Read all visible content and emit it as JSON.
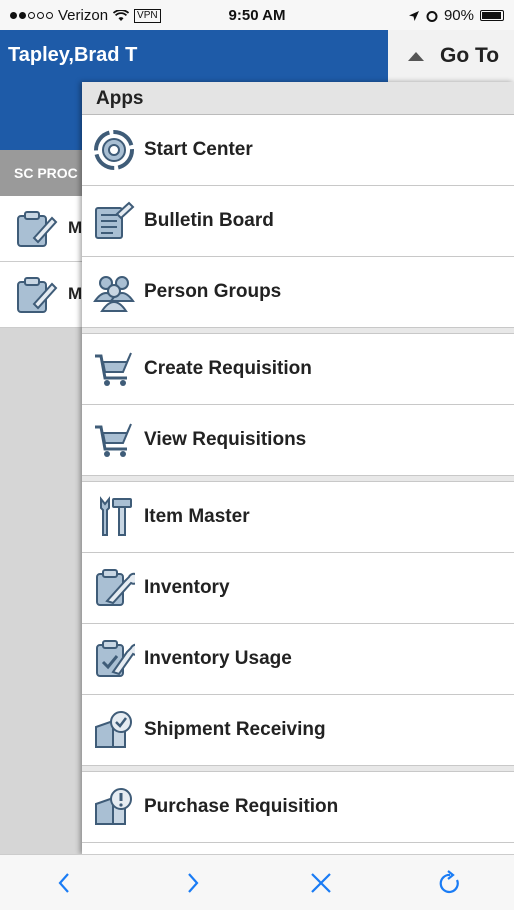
{
  "status": {
    "carrier": "Verizon",
    "vpn": "VPN",
    "time": "9:50 AM",
    "battery": "90%"
  },
  "header": {
    "user": "Tapley,Brad T",
    "goto_label": "Go To"
  },
  "background": {
    "section_label": "SC PROC",
    "rows": [
      {
        "label": "M"
      },
      {
        "label": "M"
      }
    ]
  },
  "drawer": {
    "title": "Apps",
    "groups": [
      [
        {
          "label": "Start Center",
          "icon": "start-center-icon"
        },
        {
          "label": "Bulletin Board",
          "icon": "bulletin-board-icon"
        },
        {
          "label": "Person Groups",
          "icon": "person-groups-icon"
        }
      ],
      [
        {
          "label": "Create Requisition",
          "icon": "cart-icon"
        },
        {
          "label": "View Requisitions",
          "icon": "cart-icon"
        }
      ],
      [
        {
          "label": "Item Master",
          "icon": "tools-icon"
        },
        {
          "label": "Inventory",
          "icon": "clipboard-wrench-icon"
        },
        {
          "label": "Inventory Usage",
          "icon": "clipboard-check-icon"
        },
        {
          "label": "Shipment Receiving",
          "icon": "box-check-icon"
        }
      ],
      [
        {
          "label": "Purchase Requisition",
          "icon": "box-alert-icon"
        }
      ]
    ]
  },
  "toolbar": [
    "back-icon",
    "forward-icon",
    "close-icon",
    "refresh-icon"
  ],
  "colors": {
    "brand_blue": "#1e5ba8",
    "icon_fill": "#a9bfd3",
    "icon_stroke": "#3f5c78",
    "ios_blue": "#1a7cf5"
  }
}
